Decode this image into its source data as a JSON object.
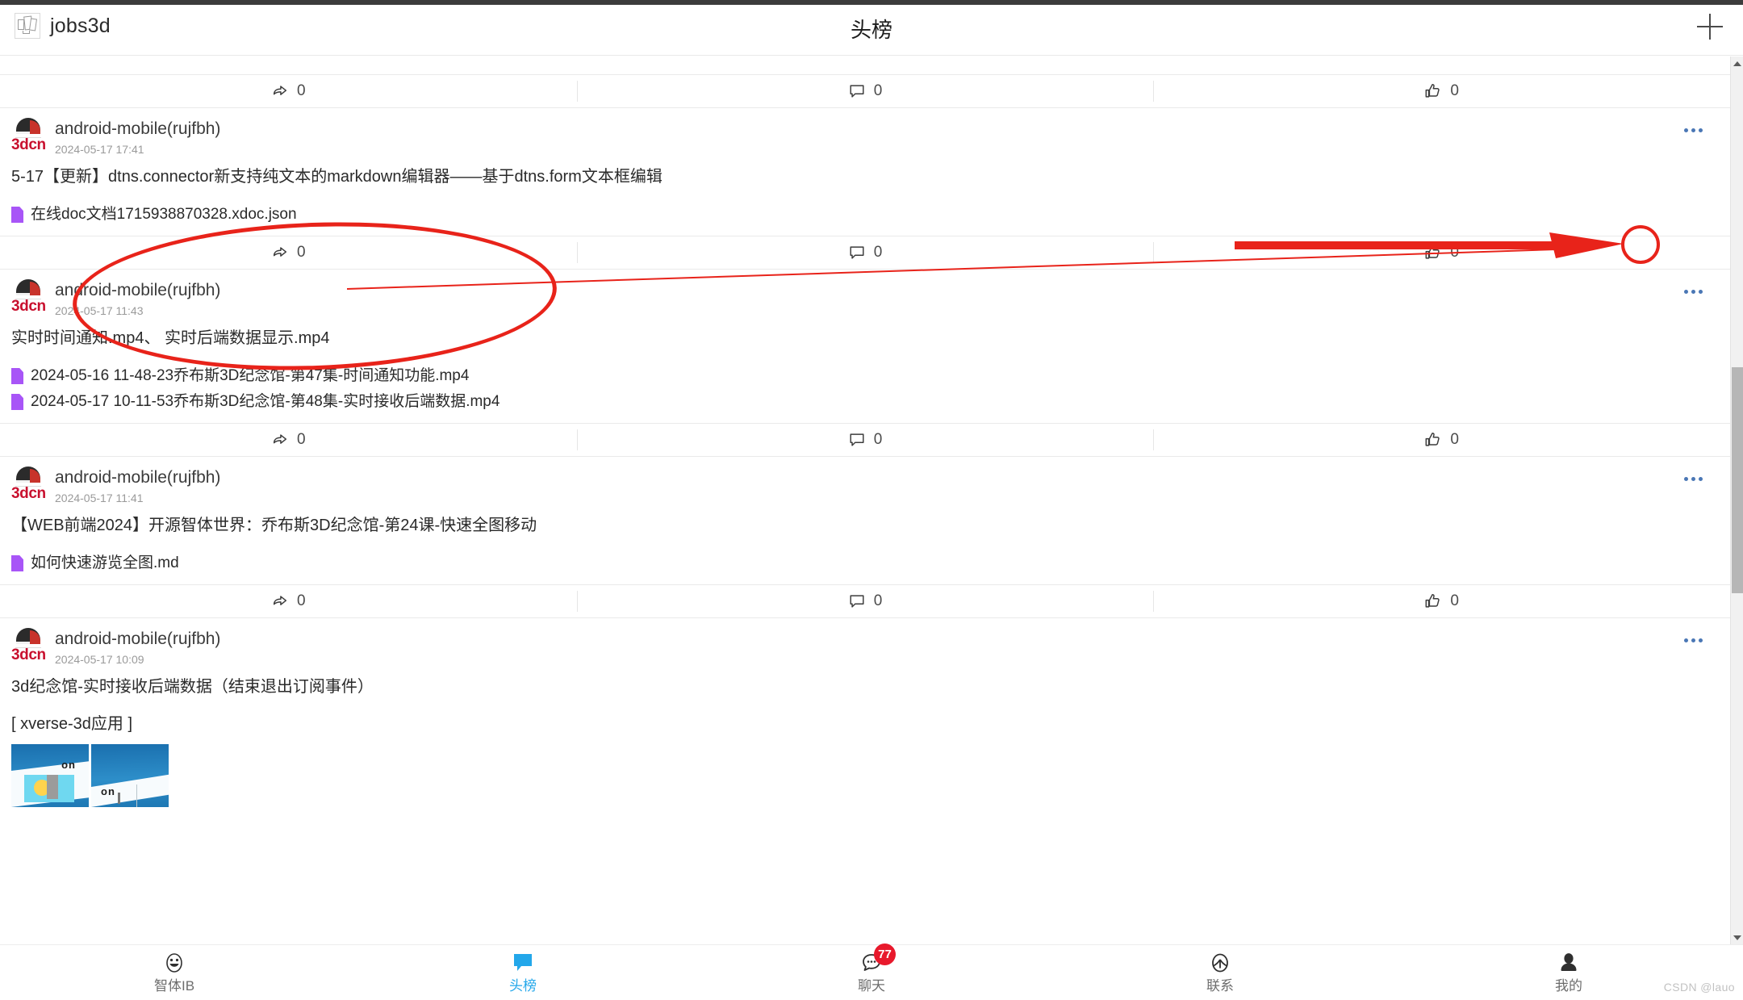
{
  "header": {
    "brand": "jobs3d",
    "title": "头榜",
    "add_label": "+",
    "logo_icon": "app-logo-icon",
    "add_icon": "plus-icon"
  },
  "actions": {
    "share_icon": "share-arrow-icon",
    "comment_icon": "comment-bubble-icon",
    "like_icon": "thumbs-up-icon",
    "more_icon": "more-horizontal-icon"
  },
  "feed": {
    "top_partial_post": {
      "share_count": "0",
      "comment_count": "0",
      "like_count": "0"
    },
    "posts": [
      {
        "author": "android-mobile(rujfbh)",
        "time": "2024-05-17 17:41",
        "avatar_mark": "3dcn",
        "text": "5-17【更新】dtns.connector新支持纯文本的markdown编辑器——基于dtns.form文本框编辑",
        "attachments": [
          "在线doc文档1715938870328.xdoc.json"
        ],
        "share_count": "0",
        "comment_count": "0",
        "like_count": "0"
      },
      {
        "author": "android-mobile(rujfbh)",
        "time": "2024-05-17 11:43",
        "avatar_mark": "3dcn",
        "text": "实时时间通知.mp4、 实时后端数据显示.mp4",
        "attachments": [
          "2024-05-16 11-48-23乔布斯3D纪念馆-第47集-时间通知功能.mp4",
          "2024-05-17 10-11-53乔布斯3D纪念馆-第48集-实时接收后端数据.mp4"
        ],
        "share_count": "0",
        "comment_count": "0",
        "like_count": "0"
      },
      {
        "author": "android-mobile(rujfbh)",
        "time": "2024-05-17 11:41",
        "avatar_mark": "3dcn",
        "text": "【WEB前端2024】开源智体世界：乔布斯3D纪念馆-第24课-快速全图移动",
        "attachments": [
          "如何快速游览全图.md"
        ],
        "share_count": "0",
        "comment_count": "0",
        "like_count": "0"
      },
      {
        "author": "android-mobile(rujfbh)",
        "time": "2024-05-17 10:09",
        "avatar_mark": "3dcn",
        "text": "3d纪念馆-实时接收后端数据（结束退出订阅事件）",
        "subtext": "[ xverse-3d应用 ]",
        "attachments": [],
        "has_thumbnails": true
      }
    ]
  },
  "annotations": {
    "ellipse_color": "#e8231a",
    "arrow_color": "#e8231a",
    "circle_color": "#e8231a"
  },
  "tabbar": {
    "items": [
      {
        "label": "智体IB",
        "icon": "smiley-face-icon",
        "active": false,
        "badge": ""
      },
      {
        "label": "头榜",
        "icon": "speech-bubble-filled-icon",
        "active": true,
        "badge": ""
      },
      {
        "label": "聊天",
        "icon": "chat-dots-icon",
        "active": false,
        "badge": "77"
      },
      {
        "label": "联系",
        "icon": "contacts-circle-icon",
        "active": false,
        "badge": ""
      },
      {
        "label": "我的",
        "icon": "person-icon",
        "active": false,
        "badge": ""
      }
    ]
  },
  "watermark": "CSDN @lauo",
  "scrollbar": {
    "up_icon": "scroll-up-arrow-icon",
    "down_icon": "scroll-down-arrow-icon"
  }
}
